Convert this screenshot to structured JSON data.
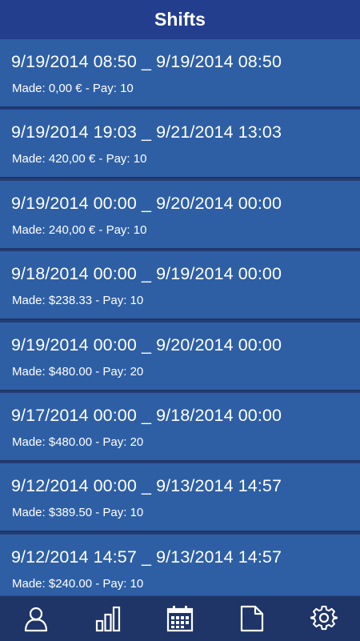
{
  "header": {
    "title": "Shifts"
  },
  "shifts": [
    {
      "range": "9/19/2014 08:50 _ 9/19/2014 08:50",
      "info": "Made: 0,00 € - Pay: 10"
    },
    {
      "range": "9/19/2014 19:03 _ 9/21/2014 13:03",
      "info": "Made: 420,00 € - Pay: 10"
    },
    {
      "range": "9/19/2014 00:00 _ 9/20/2014 00:00",
      "info": "Made: 240,00 € - Pay: 10"
    },
    {
      "range": "9/18/2014 00:00 _ 9/19/2014 00:00",
      "info": "Made: $238.33 - Pay: 10"
    },
    {
      "range": "9/19/2014 00:00 _ 9/20/2014 00:00",
      "info": "Made: $480.00 - Pay: 20"
    },
    {
      "range": "9/17/2014 00:00 _ 9/18/2014 00:00",
      "info": "Made: $480.00 - Pay: 20"
    },
    {
      "range": "9/12/2014 00:00 _ 9/13/2014 14:57",
      "info": "Made: $389.50 - Pay: 10"
    },
    {
      "range": "9/12/2014 14:57 _ 9/13/2014 14:57",
      "info": "Made: $240.00 - Pay: 10"
    }
  ],
  "tabbar": {
    "items": [
      {
        "icon": "user-icon"
      },
      {
        "icon": "bar-chart-icon"
      },
      {
        "icon": "calendar-icon"
      },
      {
        "icon": "document-icon"
      },
      {
        "icon": "gear-icon"
      }
    ]
  },
  "colors": {
    "header_bg": "#233e8d",
    "row_bg": "#2e5fa5",
    "tabbar_bg": "#1f3568",
    "text": "#ffffff"
  }
}
